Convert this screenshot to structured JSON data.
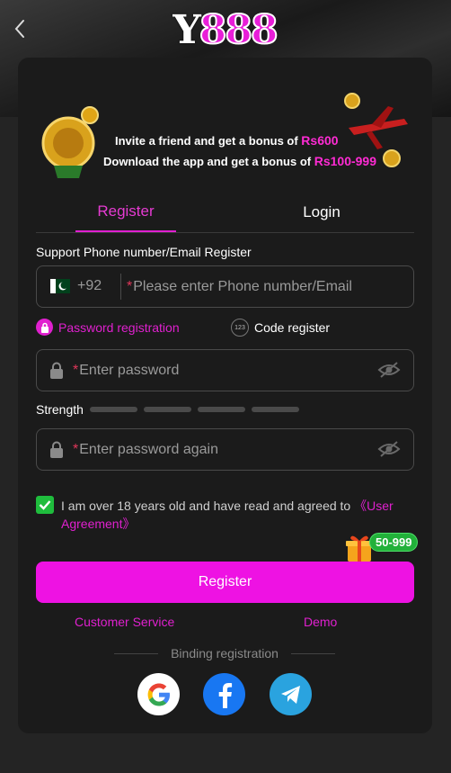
{
  "logo": {
    "y": "Y",
    "num": "888"
  },
  "banner": {
    "line1_text": "Invite a friend and get a bonus of ",
    "line1_amount": "Rs600",
    "line2_text": "Download the app and get a bonus of ",
    "line2_amount": "Rs100-999"
  },
  "tabs": {
    "register": "Register",
    "login": "Login"
  },
  "form": {
    "support_label": "Support Phone number/Email Register",
    "country_code": "+92",
    "required_mark": "*",
    "phone_placeholder": "Please enter Phone number/Email",
    "password_mode": "Password registration",
    "code_mode": "Code register",
    "code_icon_text": "123",
    "password_placeholder": "Enter password",
    "strength_label": "Strength",
    "password_again_placeholder": "Enter password again",
    "agreement_text": "I am over 18 years old and have read and agreed to ",
    "agreement_link": "《User Agreement》",
    "agreement_checked": true
  },
  "promo": {
    "badge": "50-999"
  },
  "actions": {
    "register": "Register",
    "customer_service": "Customer Service",
    "demo": "Demo"
  },
  "binding": {
    "label": "Binding registration"
  },
  "colors": {
    "accent": "#ee12e3",
    "check": "#1fbd3d",
    "background": "#1b1b1b"
  }
}
